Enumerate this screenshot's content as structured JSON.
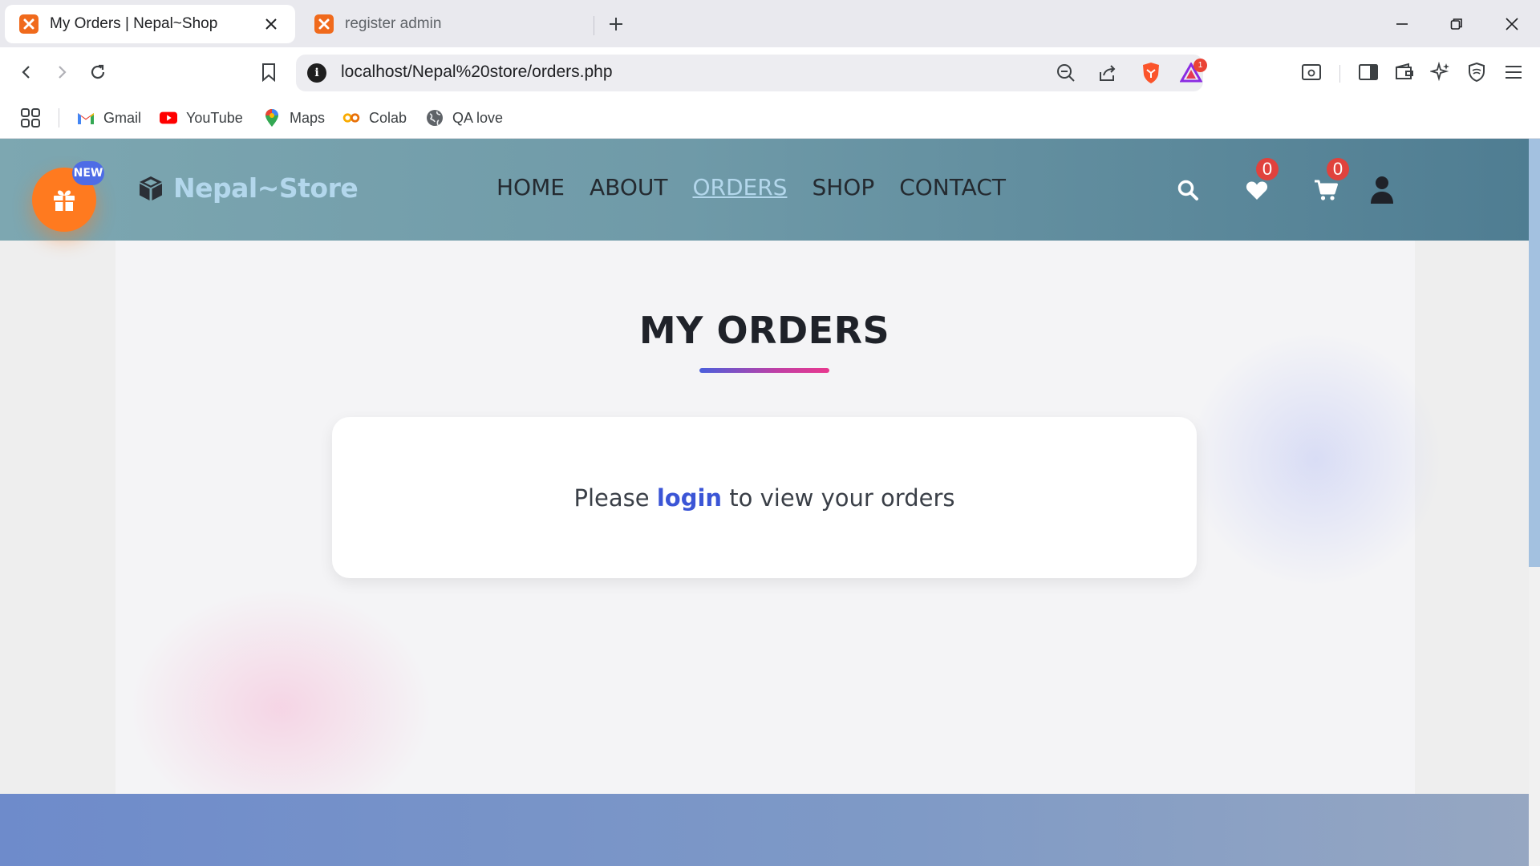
{
  "browser": {
    "tabs": [
      {
        "title": "My Orders | Nepal~Shop",
        "active": true
      },
      {
        "title": "register admin",
        "active": false
      }
    ],
    "url": "localhost/Nepal%20store/orders.php",
    "rewards_count": "1",
    "bookmarks": [
      {
        "label": "Gmail",
        "icon": "gmail-icon"
      },
      {
        "label": "YouTube",
        "icon": "youtube-icon"
      },
      {
        "label": "Maps",
        "icon": "maps-icon"
      },
      {
        "label": "Colab",
        "icon": "colab-icon"
      },
      {
        "label": "QA love",
        "icon": "globe-icon"
      }
    ]
  },
  "site": {
    "new_badge": "NEW",
    "logo_text": "Nepal~Store",
    "nav": [
      {
        "label": "HOME",
        "active": false
      },
      {
        "label": "ABOUT",
        "active": false
      },
      {
        "label": "ORDERS",
        "active": true
      },
      {
        "label": "SHOP",
        "active": false
      },
      {
        "label": "CONTACT",
        "active": false
      }
    ],
    "wishlist_count": "0",
    "cart_count": "0"
  },
  "main": {
    "title": "MY ORDERS",
    "message_prefix": "Please ",
    "message_link": "login",
    "message_suffix": " to view your orders"
  },
  "colors": {
    "accent": "#3b55d6",
    "gift": "#ff7a1f",
    "badge": "#e0423d"
  }
}
